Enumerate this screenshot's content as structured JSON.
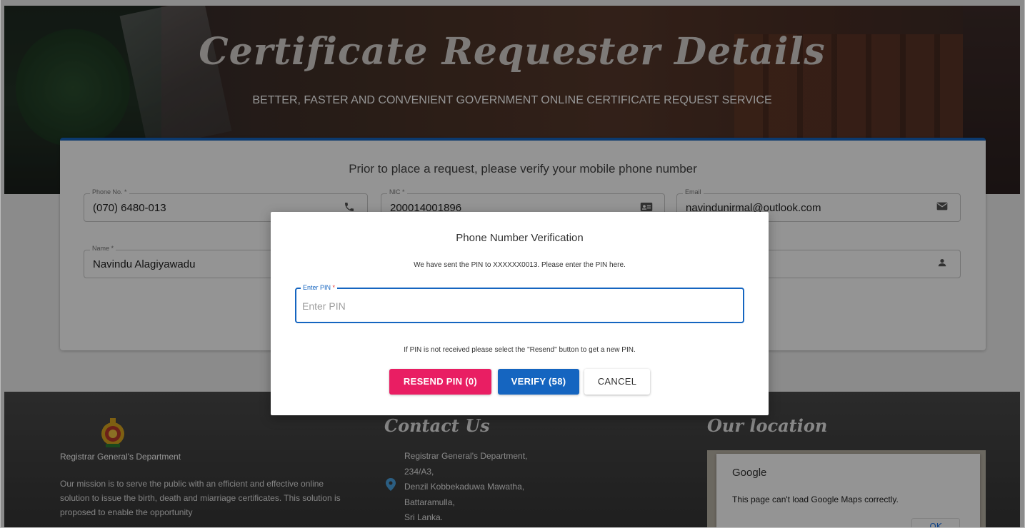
{
  "hero": {
    "title": "Certificate Requester Details",
    "subtitle": "BETTER, FASTER AND CONVENIENT GOVERNMENT ONLINE CERTIFICATE REQUEST SERVICE"
  },
  "form": {
    "heading": "Prior to place a request, please verify your mobile phone number",
    "phone": {
      "label": "Phone No. *",
      "value": "(070) 6480-013",
      "icon": "phone-icon"
    },
    "nic": {
      "label": "NIC *",
      "value": "200014001896",
      "icon": "id-card-icon"
    },
    "email": {
      "label": "Email",
      "value": "navindunirmal@outlook.com",
      "icon": "mail-icon"
    },
    "name": {
      "label": "Name *",
      "value": "Navindu Alagiyawadu"
    },
    "fifth_field": {
      "icon": "person-icon"
    }
  },
  "dialog": {
    "title": "Phone Number Verification",
    "message": "We have sent the PIN to XXXXXX0013. Please enter the PIN here.",
    "pin_label": "Enter PIN",
    "pin_required": "*",
    "pin_placeholder": "Enter PIN",
    "pin_value": "",
    "note": "If PIN is not received please select the \"Resend\" button to get a new PIN.",
    "resend_label": "RESEND PIN (0)",
    "verify_label": "VERIFY (58)",
    "cancel_label": "CANCEL"
  },
  "footer": {
    "dept_name": "Registrar General's Department",
    "mission": "Our mission is to serve the public with an efficient and effective online solution to issue the birth, death and miarriage certificates. This solution is proposed to enable the opportunity",
    "contact_title": "Contact Us",
    "address_lines": [
      "Registrar General's Department,",
      "234/A3,",
      "Denzil Kobbekaduwa Mawatha,",
      "Battaramulla,",
      "Sri Lanka."
    ],
    "location_title": "Our location",
    "map_brand": "Google",
    "map_message": "This page can't load Google Maps correctly.",
    "map_ok": "OK"
  },
  "colors": {
    "primary": "#1565c0",
    "accent": "#e91e63"
  }
}
